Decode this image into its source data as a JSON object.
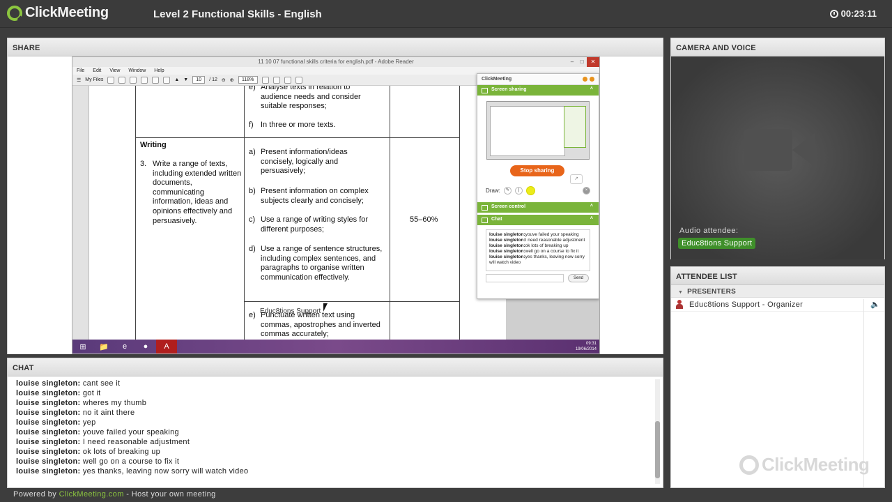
{
  "app": {
    "brand": "ClickMeeting",
    "meeting_title": "Level 2 Functional Skills - English",
    "timer": "00:23:11"
  },
  "panels": {
    "share": "SHARE",
    "camera": "CAMERA AND VOICE",
    "attendees": "ATTENDEE LIST",
    "chat": "CHAT"
  },
  "shared_window": {
    "title": "11 10 07 functional skills criteria for english.pdf - Adobe Reader",
    "menu": [
      "File",
      "Edit",
      "View",
      "Window",
      "Help"
    ],
    "toolbar": {
      "my_files": "My Files",
      "page": "10",
      "pages": "/ 12",
      "zoom": "118%"
    },
    "doc": {
      "e1_label": "e)",
      "e1": "Analyse texts in relation to audience needs and consider suitable responses;",
      "f_label": "f)",
      "f": "In three or more texts.",
      "heading": "Writing",
      "item_number": "3.",
      "item_text": "Write a range of texts, including extended written documents, communicating information, ideas and opinions effectively and persuasively.",
      "a_label": "a)",
      "a": "Present information/ideas concisely, logically and persuasively;",
      "b_label": "b)",
      "b": "Present information on complex subjects clearly and concisely;",
      "c_label": "c)",
      "c": "Use a range of writing styles for different purposes;",
      "d_label": "d)",
      "d": "Use a range of sentence structures, including complex sentences, and paragraphs to organise written communication effectively.",
      "e2_label": "e)",
      "e2": "Punctuate written text using commas, apostrophes and inverted commas accurately;",
      "percent": "55–60%"
    },
    "overlay_label": "Educ8tions Support",
    "taskbar": {
      "time": "09:31",
      "date": "19/06/2014"
    }
  },
  "cm_widget": {
    "brand": "ClickMeeting",
    "screen_sharing": "Screen sharing",
    "stop_sharing": "Stop sharing",
    "draw_label": "Draw:",
    "screen_control": "Screen control",
    "chat": "Chat",
    "send": "Send",
    "mini_chat": [
      {
        "who": "louise singleton:",
        "text": "youve failed your speaking"
      },
      {
        "who": "louise singleton:",
        "text": "I need reasonable adjustment"
      },
      {
        "who": "louise singleton:",
        "text": "ok lots of breaking up"
      },
      {
        "who": "louise singleton:",
        "text": "well go on a course to fix it"
      },
      {
        "who": "louise singleton:",
        "text": "yes thanks, leaving now sorry will watch video"
      }
    ]
  },
  "camera": {
    "audio_label": "Audio attendee:",
    "audio_name": "Educ8tions Support"
  },
  "attendee_list": {
    "section": "PRESENTERS",
    "presenter": "Educ8tions Support - Organizer"
  },
  "chat": [
    {
      "who": "louise singleton:",
      "text": "cant see it"
    },
    {
      "who": "louise singleton:",
      "text": "got it"
    },
    {
      "who": "louise singleton:",
      "text": "wheres my thumb"
    },
    {
      "who": "louise singleton:",
      "text": "no it aint there"
    },
    {
      "who": "louise singleton:",
      "text": "yep"
    },
    {
      "who": "louise singleton:",
      "text": "youve failed your speaking"
    },
    {
      "who": "louise singleton:",
      "text": "I need reasonable adjustment"
    },
    {
      "who": "louise singleton:",
      "text": "ok lots of breaking up"
    },
    {
      "who": "louise singleton:",
      "text": "well go on a course to fix it"
    },
    {
      "who": "louise singleton:",
      "text": "yes thanks, leaving now sorry will watch video"
    }
  ],
  "footer": {
    "prefix": "Powered by",
    "link": "ClickMeeting.com",
    "suffix": "- Host your own meeting"
  },
  "colors": {
    "accent_green": "#8cc63f",
    "stop_orange": "#e8651a"
  }
}
